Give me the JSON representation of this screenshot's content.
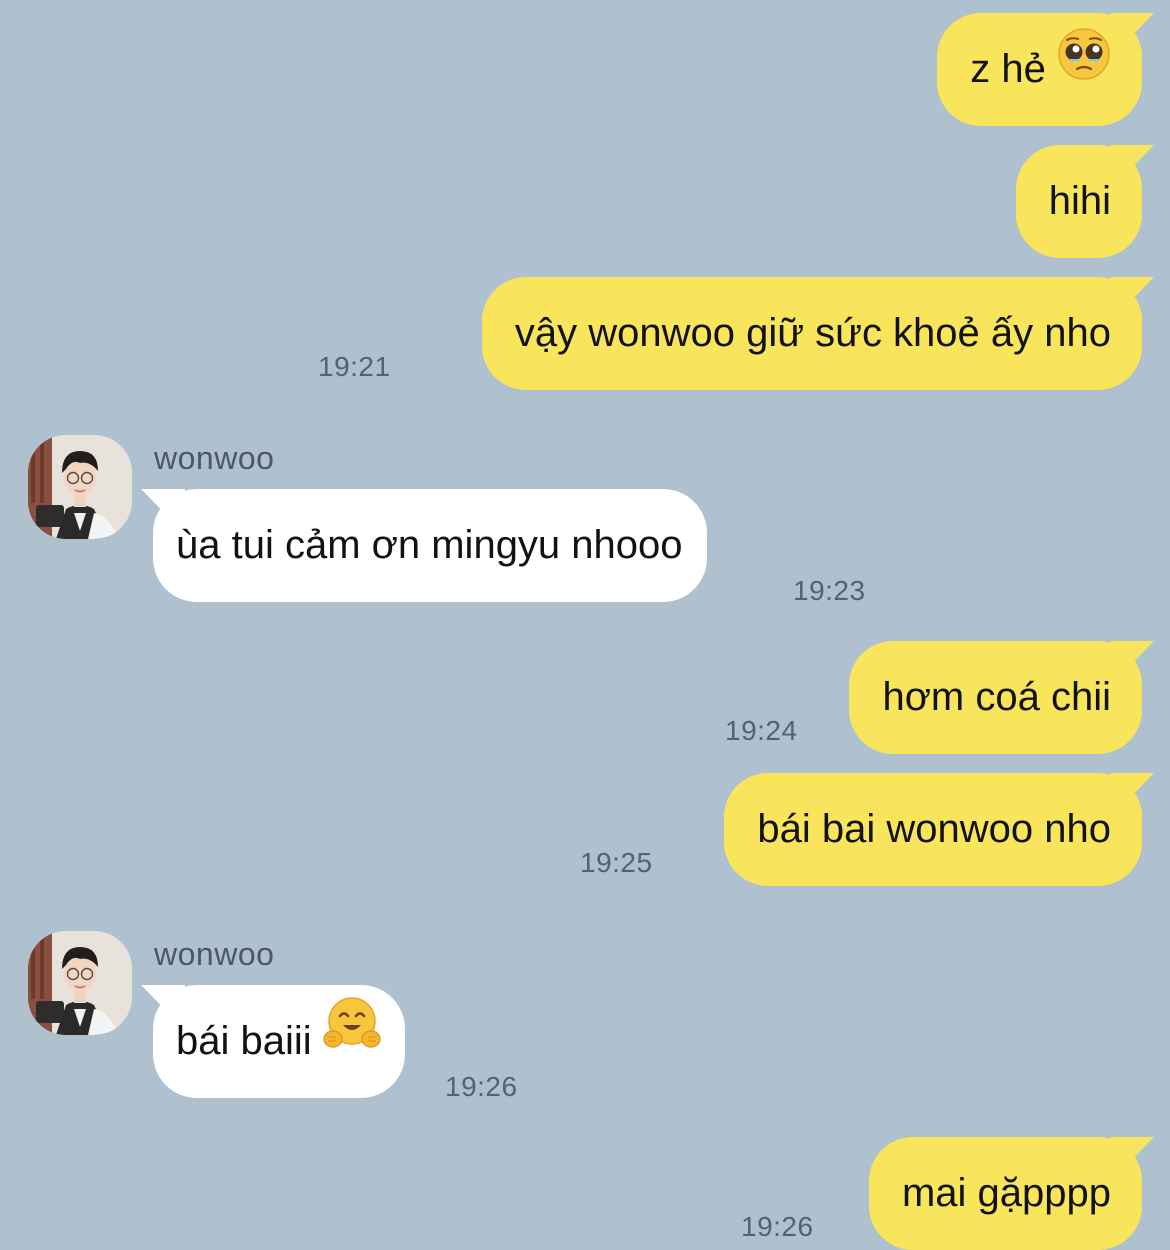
{
  "chat": {
    "contact_name": "wonwoo",
    "messages": [
      {
        "side": "out",
        "text": "z hẻ",
        "emoji": "pleading-face",
        "time": ""
      },
      {
        "side": "out",
        "text": "hihi",
        "time": ""
      },
      {
        "side": "out",
        "text": "vậy wonwoo giữ sức khoẻ ấy nho",
        "time": "19:21"
      },
      {
        "side": "in",
        "sender": "wonwoo",
        "text": "ùa tui cảm ơn mingyu nhooo",
        "time": "19:23"
      },
      {
        "side": "out",
        "text": "hơm coá chii",
        "time": "19:24"
      },
      {
        "side": "out",
        "text": "bái bai wonwoo nho",
        "time": "19:25"
      },
      {
        "side": "in",
        "sender": "wonwoo",
        "text": "bái baiii",
        "emoji": "hugging-face",
        "time": "19:26"
      },
      {
        "side": "out",
        "text": "mai gặpppp",
        "time": "19:26"
      }
    ]
  },
  "colors": {
    "background": "#afc0cf",
    "outgoing_bubble": "#f9e55b",
    "incoming_bubble": "#ffffff",
    "timestamp": "#556270"
  }
}
